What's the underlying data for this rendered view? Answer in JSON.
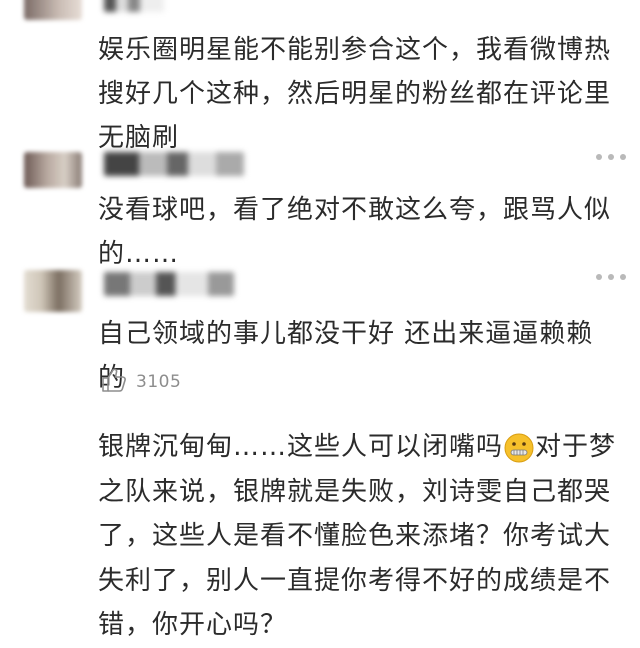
{
  "comments": [
    {
      "text": "娱乐圈明星能不能别参合这个，我看微博热搜好几个这种，然后明星的粉丝都在评论里无脑刷"
    },
    {
      "text": "没看球吧，看了绝对不敢这么夸，跟骂人似的……"
    },
    {
      "text": "自己领域的事儿都没干好 还出来逼逼赖赖的",
      "likes": "3105"
    }
  ],
  "post": {
    "text_before_emoji": "银牌沉甸甸……这些人可以闭嘴吗",
    "emoji_icon": "zipper-mouth-face-icon",
    "text_after_emoji": "对于梦之队来说，银牌就是失败，刘诗雯自己都哭了，这些人是看不懂脸色来添堵？你考试大失利了，别人一直提你考得不好的成绩是不错，你开心吗？"
  },
  "colors": {
    "text": "#2b2b2b",
    "muted": "#8d8d8d",
    "emoji_yellow": "#f6c02b"
  }
}
